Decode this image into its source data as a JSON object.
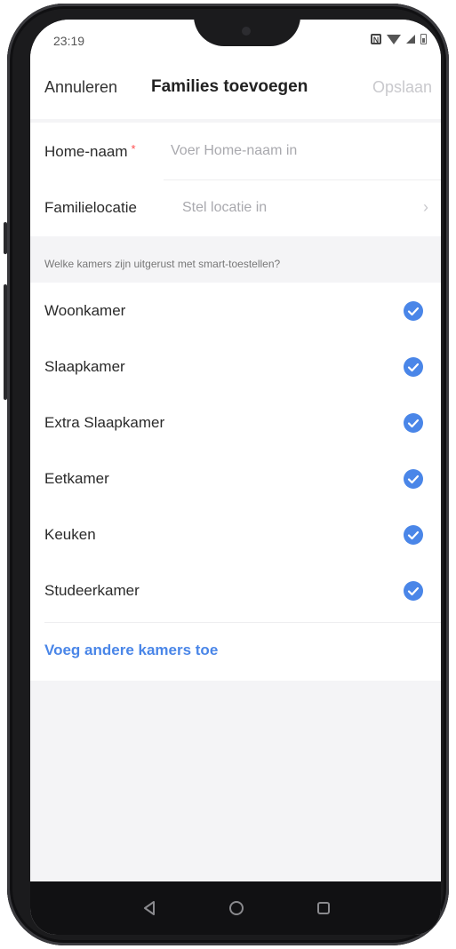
{
  "status_bar": {
    "time": "23:19"
  },
  "header": {
    "cancel": "Annuleren",
    "title": "Families toevoegen",
    "save": "Opslaan"
  },
  "form": {
    "home_name": {
      "label": "Home-naam",
      "required_mark": "*",
      "placeholder": "Voer Home-naam in"
    },
    "location": {
      "label": "Familielocatie",
      "placeholder": "Stel locatie in"
    }
  },
  "rooms_section": {
    "question": "Welke kamers zijn uitgerust met smart-toestellen?",
    "rooms": [
      {
        "label": "Woonkamer",
        "checked": true
      },
      {
        "label": "Slaapkamer",
        "checked": true
      },
      {
        "label": "Extra Slaapkamer",
        "checked": true
      },
      {
        "label": "Eetkamer",
        "checked": true
      },
      {
        "label": "Keuken",
        "checked": true
      },
      {
        "label": "Studeerkamer",
        "checked": true
      }
    ],
    "add_other": "Voeg andere kamers toe"
  },
  "colors": {
    "accent": "#4a86e8",
    "required": "#ff4d4f",
    "background": "#f4f4f6"
  },
  "icons": {
    "chevron": "chevron-right-icon",
    "check": "check-circle-icon",
    "nav": [
      "back-triangle-icon",
      "home-circle-icon",
      "recents-square-icon"
    ]
  }
}
